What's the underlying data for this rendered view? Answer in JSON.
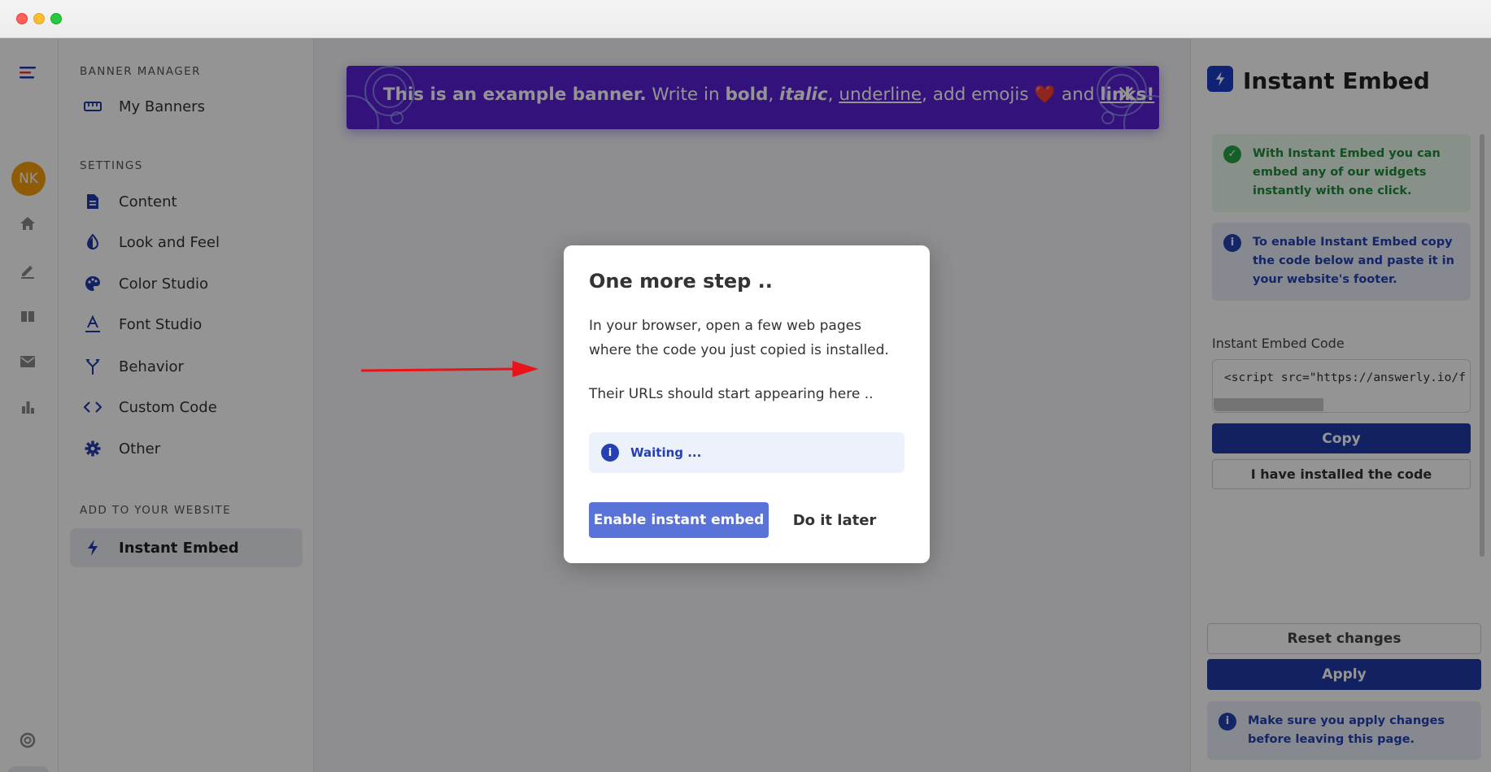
{
  "sidebar": {
    "banner_manager_title": "BANNER MANAGER",
    "my_banners": "My Banners",
    "settings_title": "SETTINGS",
    "items": [
      {
        "label": "Content",
        "icon": "document-icon"
      },
      {
        "label": "Look and Feel",
        "icon": "contrast-icon"
      },
      {
        "label": "Color Studio",
        "icon": "palette-icon"
      },
      {
        "label": "Font Studio",
        "icon": "font-icon"
      },
      {
        "label": "Behavior",
        "icon": "fork-icon"
      },
      {
        "label": "Custom Code",
        "icon": "code-icon"
      },
      {
        "label": "Other",
        "icon": "gear-icon"
      }
    ],
    "add_title": "ADD TO YOUR WEBSITE",
    "instant_embed": "Instant Embed"
  },
  "rail": {
    "avatar_initials": "NK"
  },
  "banner": {
    "lead": "This is an example banner.",
    "write_in": " Write in ",
    "bold": "bold",
    "comma1": ", ",
    "italic": "italic",
    "comma2": ", ",
    "underline": "underline",
    "add_emojis": ", add emojis ",
    "heart": "❤️",
    "and": " and ",
    "links": "links!",
    "close": "×"
  },
  "panel": {
    "title": "Instant Embed",
    "success_text": "With Instant Embed you can embed any of our widgets instantly with one click.",
    "info_text": "To enable Instant Embed copy the code below and paste it in your website's footer.",
    "code_label": "Instant Embed Code",
    "code_value": "<script src=\"https://answerly.io/f",
    "copy_label": "Copy",
    "installed_label": "I have installed the code",
    "reset_label": "Reset changes",
    "apply_label": "Apply",
    "apply_note": "Make sure you apply changes before leaving this page."
  },
  "modal": {
    "title": "One more step ..",
    "body": "In your browser, open a few web pages where the code you just copied is installed.",
    "note": "Their URLs should start appearing here ..",
    "waiting": "Waiting ...",
    "enable_label": "Enable instant embed",
    "later_label": "Do it later"
  },
  "colors": {
    "accent": "#1e3aa8",
    "banner": "#5b1fd6",
    "enable_button": "#5a73d9",
    "arrow": "#e8141a"
  }
}
